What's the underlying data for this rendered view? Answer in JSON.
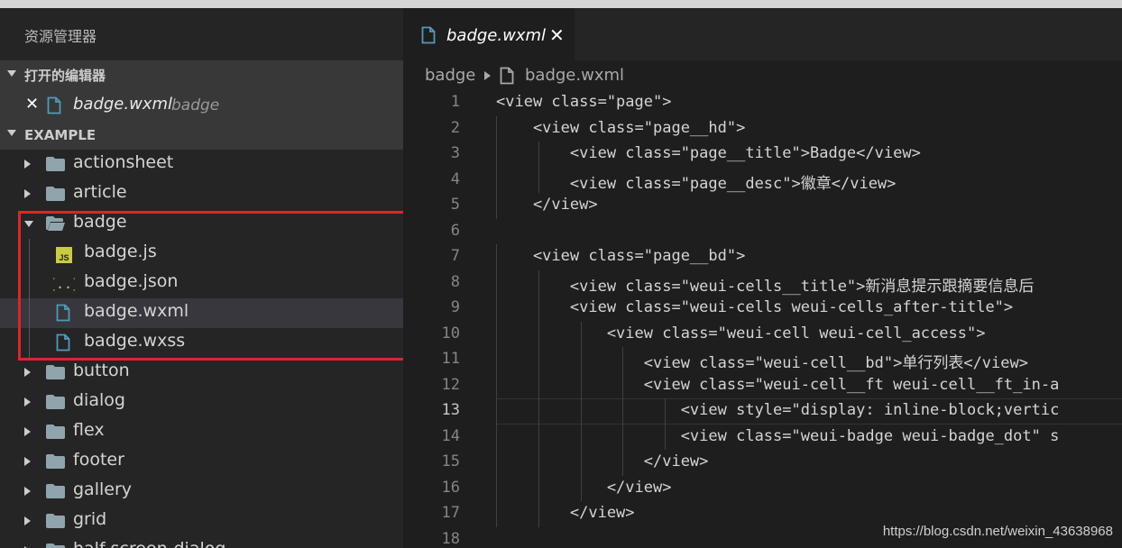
{
  "sidebar": {
    "title": "资源管理器",
    "open_editors": {
      "header": "打开的编辑器",
      "file_name": "badge.wxml",
      "file_dir": "badge"
    },
    "project": {
      "header": "EXAMPLE",
      "items": [
        {
          "type": "folder",
          "label": "actionsheet",
          "expanded": false
        },
        {
          "type": "folder",
          "label": "article",
          "expanded": false
        },
        {
          "type": "folder",
          "label": "badge",
          "expanded": true
        },
        {
          "type": "file",
          "icon": "js-icon",
          "label": "badge.js"
        },
        {
          "type": "file",
          "icon": "json-icon",
          "label": "badge.json"
        },
        {
          "type": "file",
          "icon": "file-icon",
          "label": "badge.wxml",
          "active": true
        },
        {
          "type": "file",
          "icon": "file-icon",
          "label": "badge.wxss"
        },
        {
          "type": "folder",
          "label": "button",
          "expanded": false
        },
        {
          "type": "folder",
          "label": "dialog",
          "expanded": false
        },
        {
          "type": "folder",
          "label": "flex",
          "expanded": false
        },
        {
          "type": "folder",
          "label": "footer",
          "expanded": false
        },
        {
          "type": "folder",
          "label": "gallery",
          "expanded": false
        },
        {
          "type": "folder",
          "label": "grid",
          "expanded": false
        },
        {
          "type": "folder",
          "label": "half-screen-dialog",
          "expanded": false
        }
      ]
    }
  },
  "editor": {
    "tab": {
      "label": "badge.wxml",
      "close": "✕"
    },
    "breadcrumb": {
      "dir": "badge",
      "file": "badge.wxml"
    },
    "current_line": 13,
    "lines": [
      {
        "n": "1",
        "text": "<view class=\"page\">"
      },
      {
        "n": "2",
        "text": "    <view class=\"page__hd\">"
      },
      {
        "n": "3",
        "text": "        <view class=\"page__title\">Badge</view>"
      },
      {
        "n": "4",
        "text": "        <view class=\"page__desc\">徽章</view>"
      },
      {
        "n": "5",
        "text": "    </view>"
      },
      {
        "n": "6",
        "text": ""
      },
      {
        "n": "7",
        "text": "    <view class=\"page__bd\">"
      },
      {
        "n": "8",
        "text": "        <view class=\"weui-cells__title\">新消息提示跟摘要信息后"
      },
      {
        "n": "9",
        "text": "        <view class=\"weui-cells weui-cells_after-title\">"
      },
      {
        "n": "10",
        "text": "            <view class=\"weui-cell weui-cell_access\">"
      },
      {
        "n": "11",
        "text": "                <view class=\"weui-cell__bd\">单行列表</view>"
      },
      {
        "n": "12",
        "text": "                <view class=\"weui-cell__ft weui-cell__ft_in-a"
      },
      {
        "n": "13",
        "text": "                    <view style=\"display: inline-block;vertic"
      },
      {
        "n": "14",
        "text": "                    <view class=\"weui-badge weui-badge_dot\" s"
      },
      {
        "n": "15",
        "text": "                </view>"
      },
      {
        "n": "16",
        "text": "            </view>"
      },
      {
        "n": "17",
        "text": "        </view>"
      },
      {
        "n": "18",
        "text": ""
      }
    ]
  },
  "watermark": "https://blog.csdn.net/weixin_43638968",
  "colors": {
    "highlight_box": "#e0232a",
    "file_icon": "#519aba",
    "js_icon": "#cbcb41",
    "json_icon": "#cbcb41"
  }
}
